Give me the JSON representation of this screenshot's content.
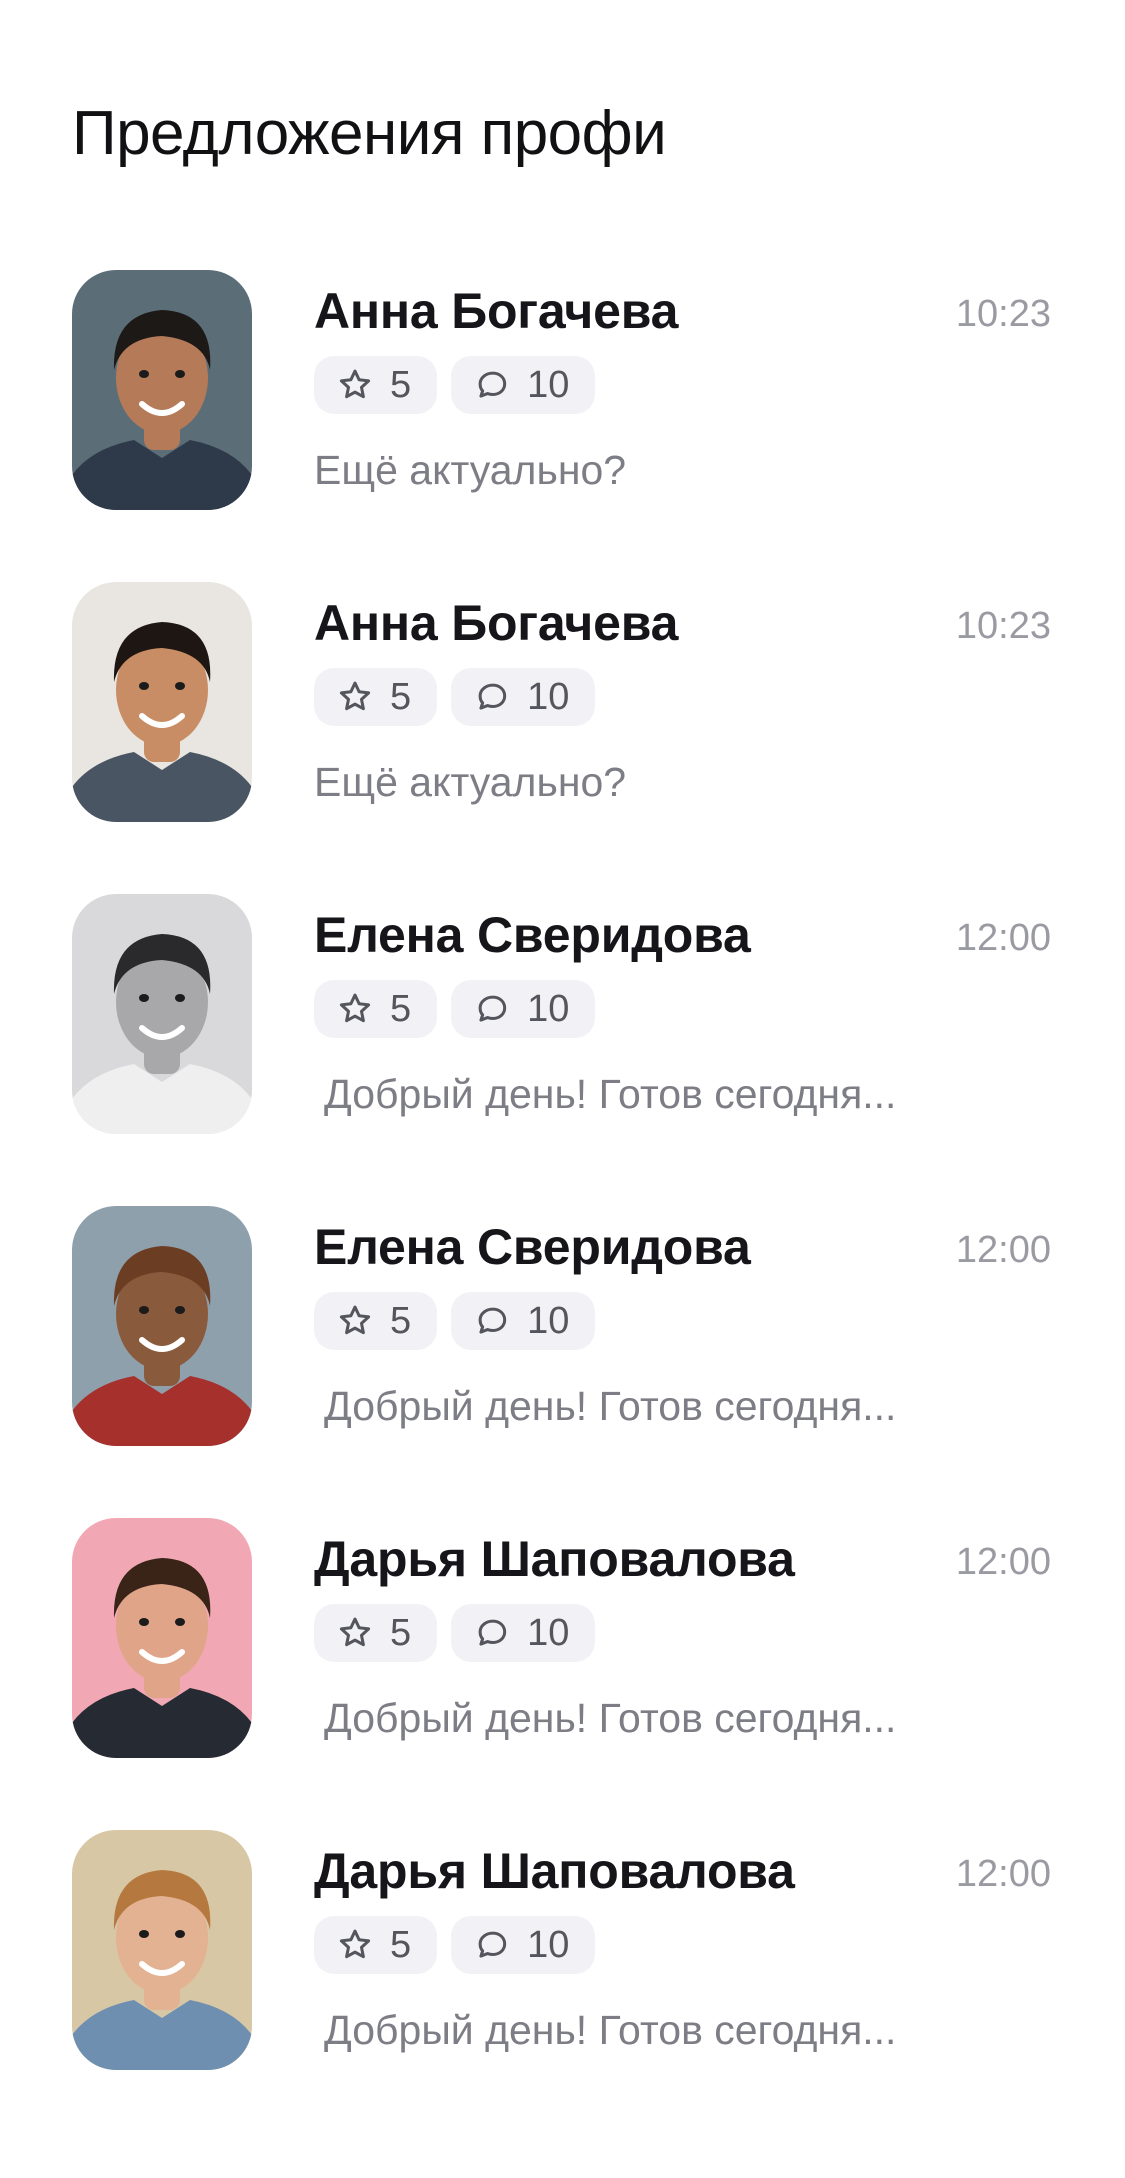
{
  "page": {
    "title": "Предложения профи"
  },
  "offers": [
    {
      "name": "Анна Богачева",
      "time": "10:23",
      "rating": "5",
      "reviews": "10",
      "message": "Ещё актуально?",
      "avatar": "portrait-man-glasses-smiling",
      "avatar_colors": {
        "bg": "#5b6e78",
        "skin": "#b57a58",
        "hair": "#1c1917",
        "shirt": "#2e3a4a"
      }
    },
    {
      "name": "Анна Богачева",
      "time": "10:23",
      "rating": "5",
      "reviews": "10",
      "message": "Ещё актуально?",
      "avatar": "portrait-man-dark-hair-smiling",
      "avatar_colors": {
        "bg": "#e9e6e2",
        "skin": "#c88d64",
        "hair": "#1e1612",
        "shirt": "#4a5563"
      }
    },
    {
      "name": "Елена Сверидова",
      "time": "12:00",
      "rating": "5",
      "reviews": "10",
      "message": "Добрый день! Готов сегодня...",
      "avatar": "portrait-man-black-and-white",
      "avatar_colors": {
        "bg": "#d9d9db",
        "skin": "#a8a8aa",
        "hair": "#2a2a2c",
        "shirt": "#efefef"
      }
    },
    {
      "name": "Елена Сверидова",
      "time": "12:00",
      "rating": "5",
      "reviews": "10",
      "message": "Добрый день! Готов сегодня...",
      "avatar": "portrait-man-dreadlocks-hiking",
      "avatar_colors": {
        "bg": "#8fa0ad",
        "skin": "#8a5a3c",
        "hair": "#6b3e24",
        "shirt": "#a5302c"
      }
    },
    {
      "name": "Дарья Шаповалова",
      "time": "12:00",
      "rating": "5",
      "reviews": "10",
      "message": "Добрый день! Готов сегодня...",
      "avatar": "portrait-man-beard-pink-background",
      "avatar_colors": {
        "bg": "#f2a8b4",
        "skin": "#e0a489",
        "hair": "#3a2418",
        "shirt": "#262a33"
      }
    },
    {
      "name": "Дарья Шаповалова",
      "time": "12:00",
      "rating": "5",
      "reviews": "10",
      "message": "Добрый день! Готов сегодня...",
      "avatar": "portrait-woman-denim-jacket",
      "avatar_colors": {
        "bg": "#d8c7a4",
        "skin": "#e2b293",
        "hair": "#b5793f",
        "shirt": "#6e8fb0"
      }
    }
  ],
  "icons": {
    "rating": "star-icon",
    "reviews": "chat-bubble-icon"
  },
  "colors": {
    "title": "#111114",
    "name": "#16161a",
    "time": "#9a9aa3",
    "message": "#7d7d86",
    "chip_bg": "#f2f2f6",
    "chip_text": "#55555e"
  }
}
